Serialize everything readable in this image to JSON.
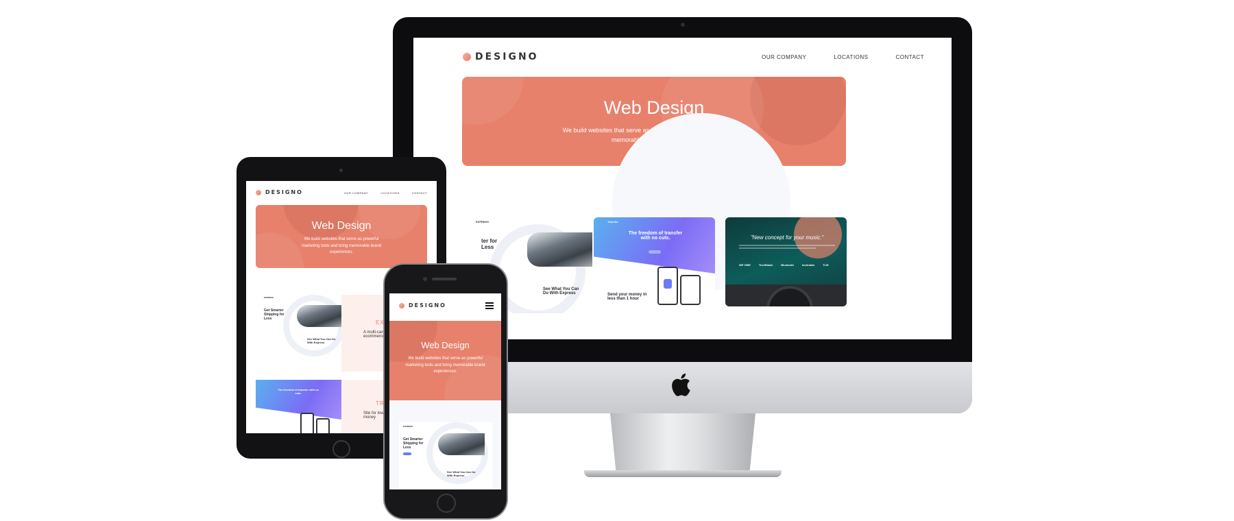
{
  "site": {
    "logo": "DESIGNO",
    "nav": [
      "OUR COMPANY",
      "LOCATIONS",
      "CONTACT"
    ],
    "hero_title": "Web Design",
    "hero_text": "We build websites that serve as powerful marketing tools and bring memorable brand experiences."
  },
  "cards": {
    "express": {
      "brand": "EXPRESS",
      "title": "Get Smarter Shipping for Less",
      "section": "See What You Can Do With Express",
      "partial_title": "ter for Less",
      "partial_section": "See What You Can Do With Express"
    },
    "transfer": {
      "brand": "Transfer",
      "title": "The freedom of transfer with no cuts.",
      "subtitle": "Send your money in less than 1 hour",
      "partial_title": "The freedom of transfer with no cuts.",
      "partial_sub": "Send your money in less than 1 hour"
    },
    "photon": {
      "quote": "\"New concept for your music.\"",
      "logos": [
        "WE VIBE",
        "TechRadar",
        "Bluetooth",
        "techradar",
        "TLM"
      ]
    },
    "ipad_side": {
      "label1": "EXPR",
      "text1": "A multi-carrier shipping ecommerce",
      "label2": "TRANS",
      "text2": "Site for low-cost sending money"
    },
    "phone_express": {
      "brand": "EXPRESS",
      "title": "Get Smarter Shipping for Less",
      "section": "See What You Can Do With Express"
    }
  },
  "colors": {
    "peach": "#e7816b",
    "dark": "#333136",
    "accent": "#6a7bf7"
  }
}
